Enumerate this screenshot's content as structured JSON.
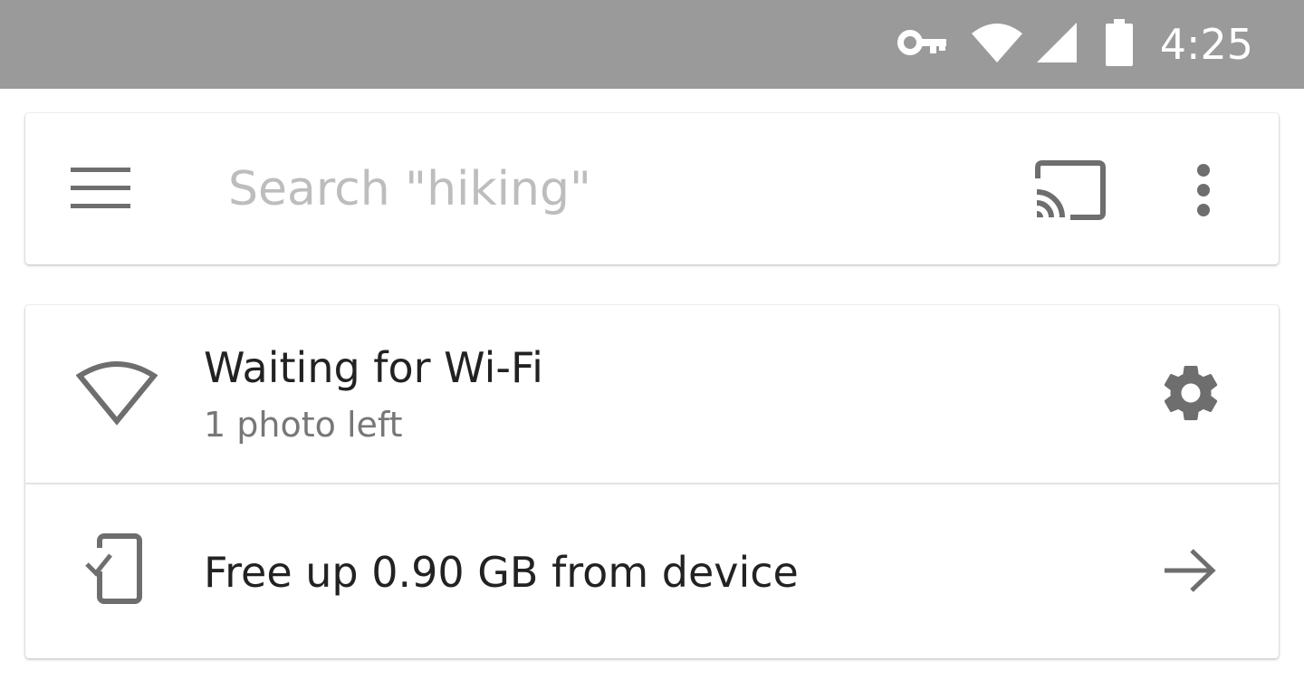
{
  "status_bar": {
    "time": "4:25",
    "icons": [
      "vpn-key-icon",
      "wifi-icon",
      "cell-signal-icon",
      "battery-icon"
    ],
    "background": "#9a9a9a"
  },
  "search_bar": {
    "menu_icon": "menu-icon",
    "placeholder": "Search \"hiking\"",
    "cast_icon": "cast-icon",
    "overflow_icon": "more-vert-icon"
  },
  "backup_status": {
    "wifi_row": {
      "icon": "wifi-outline-icon",
      "title": "Waiting for Wi-Fi",
      "subtitle": "1 photo left",
      "action_icon": "settings-gear-icon"
    },
    "free_up_row": {
      "icon": "phone-check-icon",
      "title": "Free up 0.90 GB from device",
      "action_icon": "arrow-right-icon"
    }
  },
  "colors": {
    "icon_gray": "#6e6e6e",
    "text_primary": "#222222",
    "text_secondary": "#777777",
    "placeholder": "#bdbdbd"
  }
}
